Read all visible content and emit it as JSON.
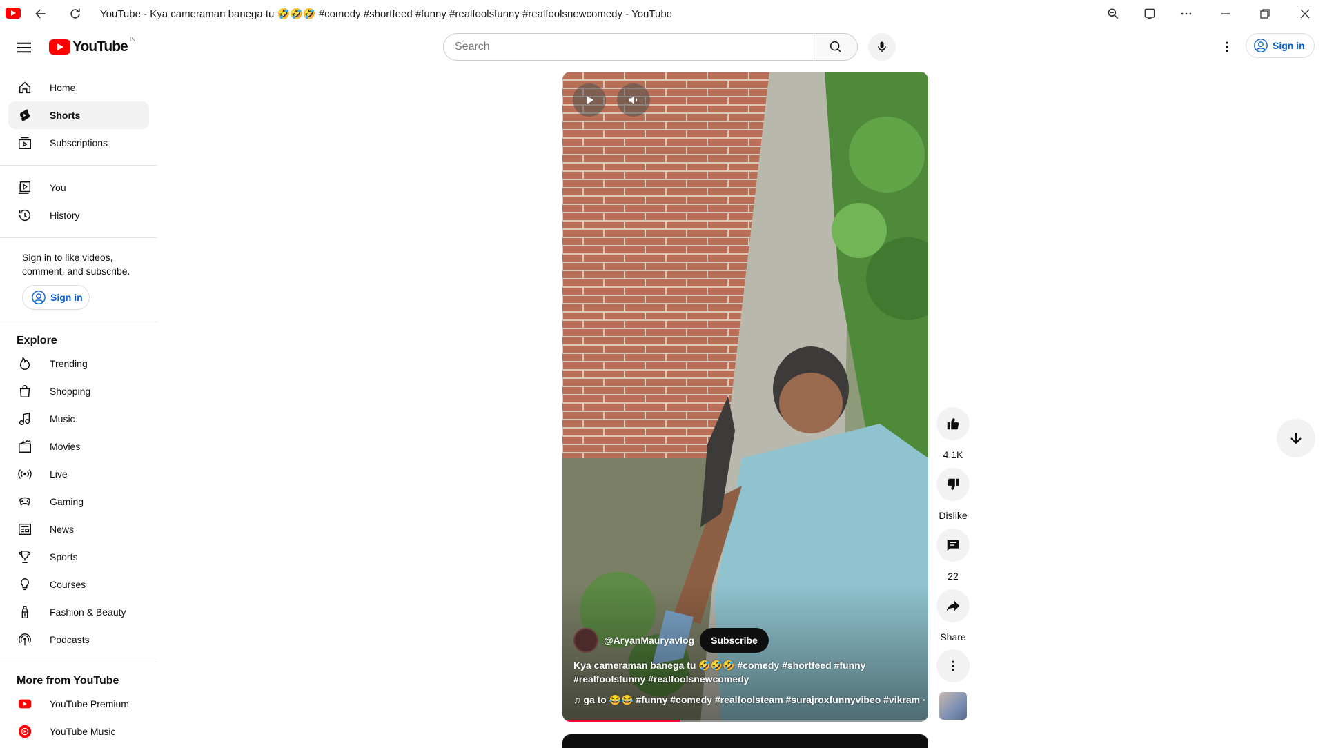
{
  "browser": {
    "title": "YouTube - Kya cameraman banega tu 🤣🤣🤣 #comedy #shortfeed #funny #realfoolsfunny #realfoolsnewcomedy - YouTube"
  },
  "masthead": {
    "logo_text": "YouTube",
    "country_code": "IN",
    "search_placeholder": "Search",
    "signin_label": "Sign in"
  },
  "sidebar": {
    "main": [
      {
        "label": "Home",
        "icon": "home-icon"
      },
      {
        "label": "Shorts",
        "icon": "shorts-icon",
        "active": true
      },
      {
        "label": "Subscriptions",
        "icon": "subscriptions-icon"
      }
    ],
    "you": [
      {
        "label": "You",
        "icon": "you-icon"
      },
      {
        "label": "History",
        "icon": "history-icon"
      }
    ],
    "signin_prompt": "Sign in to like videos, comment, and subscribe.",
    "signin_label": "Sign in",
    "explore_title": "Explore",
    "explore": [
      {
        "label": "Trending",
        "icon": "trending-icon"
      },
      {
        "label": "Shopping",
        "icon": "shopping-icon"
      },
      {
        "label": "Music",
        "icon": "music-icon"
      },
      {
        "label": "Movies",
        "icon": "movies-icon"
      },
      {
        "label": "Live",
        "icon": "live-icon"
      },
      {
        "label": "Gaming",
        "icon": "gaming-icon"
      },
      {
        "label": "News",
        "icon": "news-icon"
      },
      {
        "label": "Sports",
        "icon": "sports-icon"
      },
      {
        "label": "Courses",
        "icon": "courses-icon"
      },
      {
        "label": "Fashion & Beauty",
        "icon": "fashion-icon"
      },
      {
        "label": "Podcasts",
        "icon": "podcasts-icon"
      }
    ],
    "more_title": "More from YouTube",
    "more": [
      {
        "label": "YouTube Premium",
        "icon": "youtube-premium-icon"
      },
      {
        "label": "YouTube Music",
        "icon": "youtube-music-icon"
      }
    ]
  },
  "short": {
    "channel_handle": "@AryanMauryavlog",
    "subscribe_label": "Subscribe",
    "caption": "Kya cameraman banega tu 🤣🤣🤣 #comedy #shortfeed #funny #realfoolsfunny #realfoolsnewcomedy",
    "music_line": "♫ ga to 😂😂 #funny #comedy #realfoolsteam #surajroxfunnyvibeo #vikram · @r",
    "progress_fraction": 0.32
  },
  "actions": {
    "like_count": "4.1K",
    "dislike_label": "Dislike",
    "comment_count": "22",
    "share_label": "Share"
  },
  "colors": {
    "brand_red": "#ff0000",
    "link_blue": "#065fd4",
    "progress_red": "#ff0033"
  }
}
